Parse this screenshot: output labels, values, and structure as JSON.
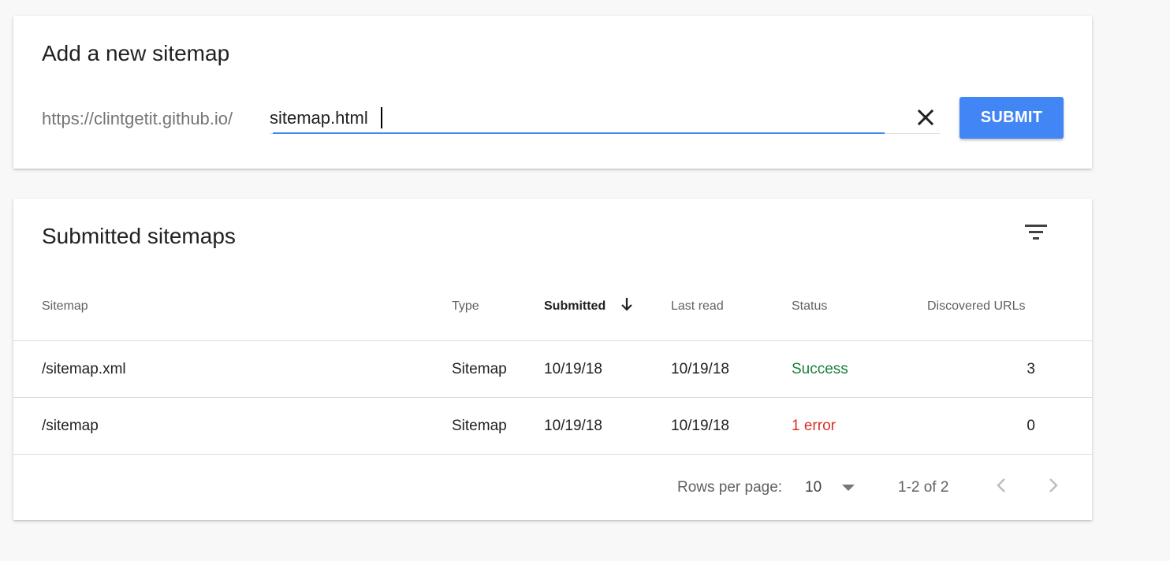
{
  "add_sitemap": {
    "title": "Add a new sitemap",
    "url_prefix": "https://clintgetit.github.io/",
    "input_value": "sitemap.html",
    "clear_icon": "close-icon",
    "submit_label": "SUBMIT",
    "accent_color": "#4285f4"
  },
  "submitted": {
    "title": "Submitted sitemaps",
    "filter_icon": "filter-icon",
    "columns": {
      "sitemap": "Sitemap",
      "type": "Type",
      "submitted": "Submitted",
      "last_read": "Last read",
      "status": "Status",
      "discovered_urls": "Discovered URLs"
    },
    "sort": {
      "column": "Submitted",
      "direction": "descending",
      "icon": "arrow-down-icon"
    },
    "rows": [
      {
        "sitemap": "/sitemap.xml",
        "type": "Sitemap",
        "submitted": "10/19/18",
        "last_read": "10/19/18",
        "status": "Success",
        "status_color": "#188038",
        "discovered_urls": "3"
      },
      {
        "sitemap": "/sitemap",
        "type": "Sitemap",
        "submitted": "10/19/18",
        "last_read": "10/19/18",
        "status": "1 error",
        "status_color": "#d93025",
        "discovered_urls": "0"
      }
    ],
    "pagination": {
      "rows_per_page_label": "Rows per page:",
      "rows_per_page_value": "10",
      "range_label": "1-2 of 2"
    }
  }
}
